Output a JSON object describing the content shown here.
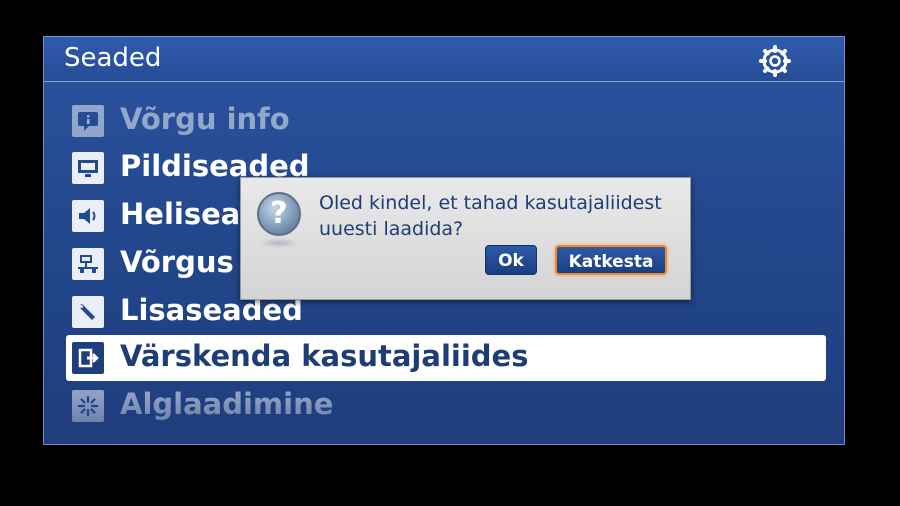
{
  "window": {
    "title": "Seaded",
    "settings_icon": "gear-icon"
  },
  "menu": {
    "items": [
      {
        "label": "Võrgu info",
        "icon": "info-icon",
        "state": "disabled"
      },
      {
        "label": "Pildiseaded",
        "icon": "monitor-icon",
        "state": "normal"
      },
      {
        "label": "Heliseaded",
        "icon": "speaker-icon",
        "state": "normal"
      },
      {
        "label": "Võrgus",
        "icon": "network-icon",
        "state": "normal"
      },
      {
        "label": "Lisaseaded",
        "icon": "wrench-icon",
        "state": "normal"
      },
      {
        "label": "Värskenda kasutajaliides",
        "icon": "refresh-exit-icon",
        "state": "selected"
      },
      {
        "label": "Alglaadimine",
        "icon": "reset-icon",
        "state": "disabled"
      }
    ]
  },
  "dialog": {
    "icon": "question-icon",
    "message_line1": "Oled kindel, et tahad kasutajaliidest",
    "message_line2": "uuesti laadida?",
    "ok_label": "Ok",
    "cancel_label": "Katkesta",
    "focused_button": "Katkesta"
  },
  "colors": {
    "panel_blue": "#24498f",
    "selected_text": "#1e3d78",
    "focus_orange": "#f08a2a"
  }
}
